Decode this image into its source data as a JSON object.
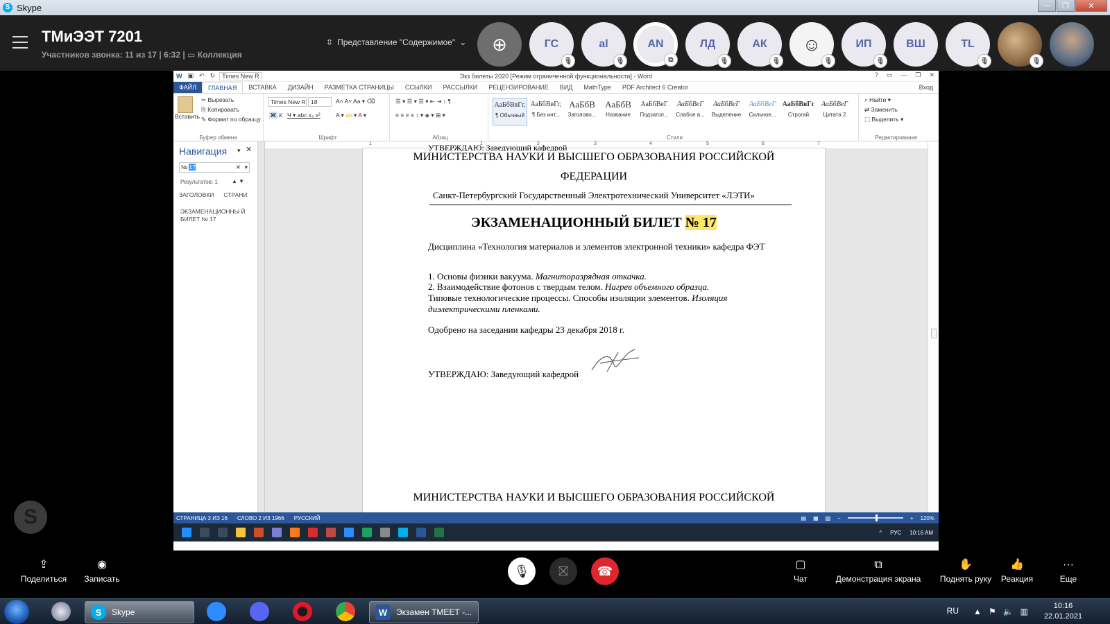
{
  "skype_window": {
    "title": "Skype"
  },
  "call": {
    "title": "ТМиЭЭТ 7201",
    "participants": "Участников звонка: 11 из 17",
    "duration": "6:32",
    "collection": "Коллекция",
    "view_mode": "Представление \"Содержимое\""
  },
  "participants": [
    {
      "initials": "ГС",
      "muted": true
    },
    {
      "initials": "al",
      "muted": true
    },
    {
      "initials": "AN",
      "muted": false,
      "speaking": true
    },
    {
      "initials": "ЛД",
      "muted": true
    },
    {
      "initials": "АК",
      "muted": true
    },
    {
      "initials": "",
      "muted": true
    },
    {
      "initials": "ИП",
      "muted": true
    },
    {
      "initials": "ВШ",
      "muted": false
    },
    {
      "initials": "TL",
      "muted": true
    },
    {
      "initials": "",
      "muted": true
    },
    {
      "initials": "",
      "muted": false
    }
  ],
  "word": {
    "title": "Экз билеты 2020 [Режим ограниченной функциональности] - Word",
    "font_box": "Times New R",
    "tabs": [
      "ФАЙЛ",
      "ГЛАВНАЯ",
      "ВСТАВКА",
      "ДИЗАЙН",
      "РАЗМЕТКА СТРАНИЦЫ",
      "ССЫЛКИ",
      "РАССЫЛКИ",
      "РЕЦЕНЗИРОВАНИЕ",
      "ВИД",
      "MathType",
      "PDF Architect 6 Creator"
    ],
    "sign_in": "Вход",
    "ribbon": {
      "paste": "Вставить",
      "cut": "Вырезать",
      "copy": "Копировать",
      "format_painter": "Формат по образцу",
      "clipboard_label": "Буфер обмена",
      "font_name": "Times New R",
      "font_size": "18",
      "font_label": "Шрифт",
      "paragraph_label": "Абзац",
      "styles_label": "Стили",
      "editing_label": "Редактирование",
      "find": "Найти",
      "replace": "Заменить",
      "select": "Выделить",
      "styles": [
        {
          "preview": "АаБбВвГг,",
          "name": "¶ Обычный"
        },
        {
          "preview": "АаБбВвГг,",
          "name": "¶ Без инт..."
        },
        {
          "preview": "АаБбВ",
          "name": "Заголово..."
        },
        {
          "preview": "АаБбВ",
          "name": "Название"
        },
        {
          "preview": "АаБбВеГ",
          "name": "Подзагол..."
        },
        {
          "preview": "АаБбВеГ",
          "name": "Слабое в..."
        },
        {
          "preview": "АаБбВеГ",
          "name": "Выделение"
        },
        {
          "preview": "АаБбВеГ",
          "name": "Сильное..."
        },
        {
          "preview": "АаБбВвГг",
          "name": "Строгий"
        },
        {
          "preview": "АаБбВеГ",
          "name": "Цитата 2"
        }
      ]
    },
    "nav": {
      "title": "Навигация",
      "search_prefix": "№ ",
      "search_highlight": "17",
      "results": "Результатов: 1",
      "tab_headings": "ЗАГОЛОВКИ",
      "tab_pages": "СТРАНИ",
      "result_text": "ЭКЗАМЕНАЦИОННЫ Й БИЛЕТ № 17"
    },
    "ruler": [
      "1",
      "1",
      "2",
      "3",
      "4",
      "5",
      "6",
      "7"
    ],
    "document": {
      "top_partial": "УТВЕРЖДАЮ: Заведующий кафедрой",
      "ministry_line1": "МИНИСТЕРСТВА НАУКИ И ВЫСШЕГО ОБРАЗОВАНИЯ РОССИЙСКОЙ",
      "ministry_line2": "ФЕДЕРАЦИИ",
      "university": "Санкт-Петербургский Государственный Электротехнический Университет «ЛЭТИ»",
      "ticket_title": "ЭКЗАМЕНАЦИОННЫЙ БИЛЕТ ",
      "ticket_number": "№ 17",
      "discipline": "Дисциплина «Технология материалов и элементов электронной техники» кафедра ФЭТ",
      "q1_plain": "1. Основы физики вакуума. ",
      "q1_italic": "Магниторазрядная откачка.",
      "q2_plain": "2. Взаимодействие фотонов с твердым телом. ",
      "q2_italic": "Нагрев объемного образца.",
      "q3_plain": "Типовые технологические процессы. Способы изоляции элементов. ",
      "q3_italic_1": "Изоляция",
      "q3_italic_2": "диэлектрическими пленками.",
      "approved": "Одобрено на заседании кафедры 23 декабря 2018 г.",
      "approve_head": "УТВЕРЖДАЮ: Заведующий кафедрой",
      "next_ministry": "МИНИСТЕРСТВА НАУКИ И ВЫСШЕГО ОБРАЗОВАНИЯ РОССИЙСКОЙ"
    },
    "status": {
      "page": "СТРАНИЦА 3 ИЗ 16",
      "words": "СЛОВО 2 ИЗ 1966",
      "lang": "РУССКИЙ",
      "zoom": "120%"
    },
    "inner_taskbar": {
      "lang": "РУС",
      "time": "10:16 AM"
    }
  },
  "controls": {
    "share": "Поделиться",
    "record": "Записать",
    "chat": "Чат",
    "screen_share": "Демонстрация экрана",
    "raise_hand": "Поднять руку",
    "reaction": "Реакция",
    "more": "Еще"
  },
  "taskbar": {
    "skype_task": "Skype",
    "word_task": "Экзамен ТМЕЕТ -...",
    "lang": "RU",
    "time": "10:16",
    "date": "22.01.2021"
  },
  "colors": {
    "word_blue": "#2b579a",
    "skype_bg": "#1f1f1f",
    "end_call": "#e0262d",
    "highlight": "#ffe666"
  }
}
